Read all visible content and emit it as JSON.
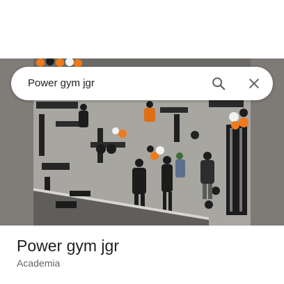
{
  "search": {
    "query": "Power gym jgr",
    "search_icon": "search-icon",
    "close_icon": "close-icon"
  },
  "place": {
    "name": "Power gym jgr",
    "category": "Academia"
  },
  "photo": {
    "subject": "gym-interior-photo",
    "accent_colors": [
      "#ef7a1a",
      "#1d1d1d",
      "#f2f2f2"
    ]
  }
}
